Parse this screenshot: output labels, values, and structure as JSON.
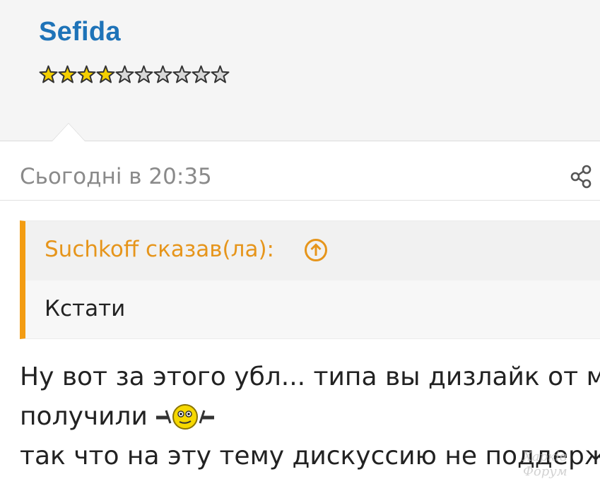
{
  "user": {
    "name": "Sefida",
    "rating": {
      "filled": 4,
      "total": 10
    }
  },
  "post": {
    "time": "Сьогодні в 20:35",
    "quote": {
      "author": "Suchkoff сказав(ла):",
      "text": "Кстати"
    },
    "message_lines": [
      "Ну вот за этого убл... типа вы дизлайк от м",
      "получили",
      "так что на эту тему дискуссию не поддерж"
    ]
  },
  "icons": {
    "share": "share-icon",
    "quote_jump": "arrow-up-circle-icon",
    "rating_star": "star-icon",
    "smiley": "smiley-icon"
  },
  "colors": {
    "username": "#1e73b8",
    "quote_accent": "#f39c12",
    "star_filled": "#f5d000",
    "star_empty": "#d8d8d8"
  },
  "watermark": "Харків Форум"
}
